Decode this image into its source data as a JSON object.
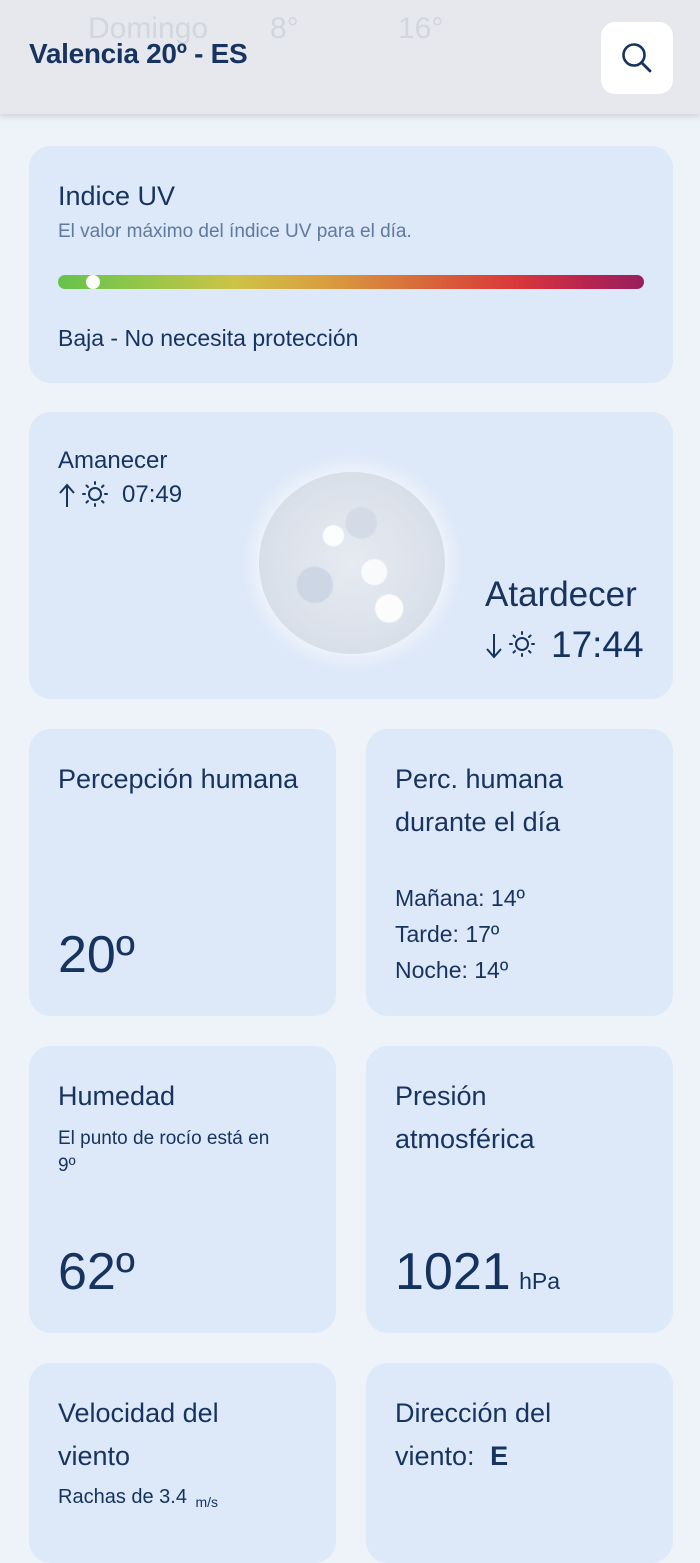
{
  "header": {
    "title": "Valencia 20º - ES",
    "ghost_day": "Domingo",
    "ghost_low": "8°",
    "ghost_high": "16°"
  },
  "uv": {
    "title": "Indice UV",
    "subtitle": "El valor máximo del índice UV para el día.",
    "level_text": "Baja - No necesita protección",
    "level_fraction": 0.06
  },
  "sun": {
    "sunrise_label": "Amanecer",
    "sunrise_time": "07:49",
    "sunset_label": "Atardecer",
    "sunset_time": "17:44"
  },
  "feels_like": {
    "title": "Percepción humana",
    "value": "20º"
  },
  "feels_day": {
    "title_line1": "Perc. humana",
    "title_line2": "durante el día",
    "morning": "Mañana: 14º",
    "afternoon": "Tarde: 17º",
    "night": "Noche: 14º"
  },
  "humidity": {
    "title": "Humedad",
    "subtitle_line1": "El punto de rocío está en",
    "subtitle_line2": "9º",
    "value": "62º"
  },
  "pressure": {
    "title_line1": "Presión",
    "title_line2": "atmosférica",
    "value": "1021",
    "unit": "hPa"
  },
  "wind_speed": {
    "title_line1": "Velocidad del",
    "title_line2": "viento",
    "gusts_label": "Rachas de 3.4",
    "gusts_unit": "m/s"
  },
  "wind_direction": {
    "title_line1": "Dirección del",
    "title_line2_label": "viento:",
    "direction": "E"
  },
  "colors": {
    "card": "#dde8f8",
    "text": "#17335f",
    "background": "#eef2f9"
  }
}
